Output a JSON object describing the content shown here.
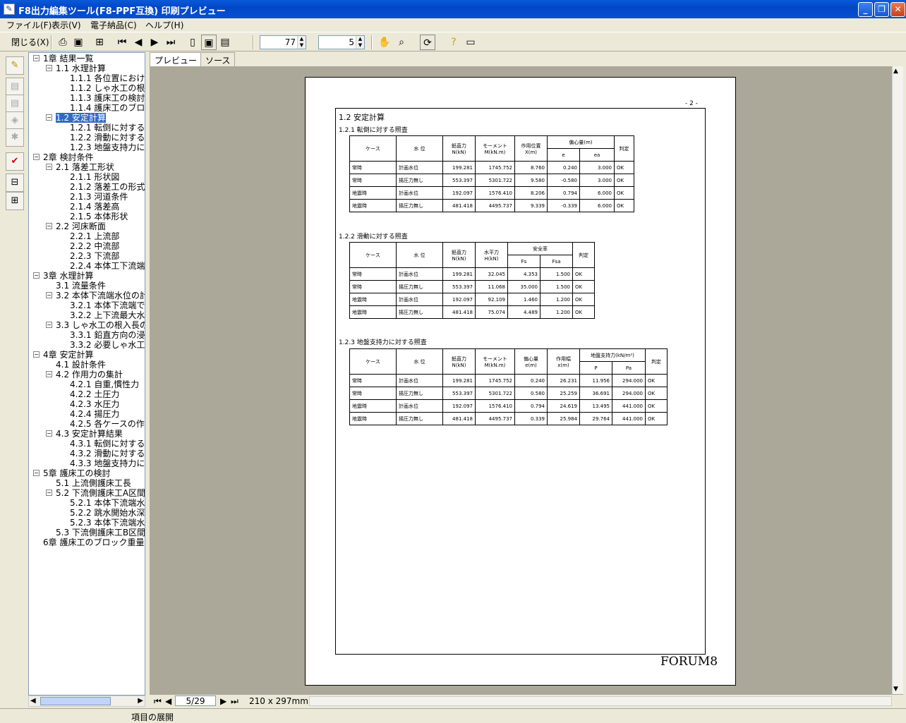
{
  "window": {
    "title": "F8出力編集ツール(F8-PPF互換) 印刷プレビュー",
    "app_icon": "edit-icon"
  },
  "menu": [
    "ファイル(F)",
    "表示(V)",
    "電子納品(C)",
    "ヘルプ(H)"
  ],
  "toolbar": {
    "close_label": "閉じる(X)",
    "zoom_value": "77",
    "pages_value": "5"
  },
  "tree": [
    {
      "label": "1章 結果一覧",
      "level": 0,
      "exp": "−"
    },
    {
      "label": "1.1 水理計算",
      "level": 1,
      "exp": "−"
    },
    {
      "label": "1.1.1 各位置におけ",
      "level": 2
    },
    {
      "label": "1.1.2 しゃ水工の根",
      "level": 2
    },
    {
      "label": "1.1.3 護床工の検討",
      "level": 2
    },
    {
      "label": "1.1.4 護床工のブロ",
      "level": 2
    },
    {
      "label": "1.2 安定計算",
      "level": 1,
      "exp": "−",
      "selected": true
    },
    {
      "label": "1.2.1 転倒に対する",
      "level": 2
    },
    {
      "label": "1.2.2 滑動に対する",
      "level": 2
    },
    {
      "label": "1.2.3 地盤支持力に",
      "level": 2
    },
    {
      "label": "2章 検討条件",
      "level": 0,
      "exp": "−"
    },
    {
      "label": "2.1 落差工形状",
      "level": 1,
      "exp": "−"
    },
    {
      "label": "2.1.1 形状図",
      "level": 2
    },
    {
      "label": "2.1.2 落差工の形式",
      "level": 2
    },
    {
      "label": "2.1.3 河道条件",
      "level": 2
    },
    {
      "label": "2.1.4 落差高",
      "level": 2
    },
    {
      "label": "2.1.5 本体形状",
      "level": 2
    },
    {
      "label": "2.2 河床断面",
      "level": 1,
      "exp": "−"
    },
    {
      "label": "2.2.1 上流部",
      "level": 2
    },
    {
      "label": "2.2.2 中流部",
      "level": 2
    },
    {
      "label": "2.2.3 下流部",
      "level": 2
    },
    {
      "label": "2.2.4 本体工下流端",
      "level": 2
    },
    {
      "label": "3章 水理計算",
      "level": 0,
      "exp": "−"
    },
    {
      "label": "3.1 流量条件",
      "level": 1
    },
    {
      "label": "3.2 本体下流端水位の計",
      "level": 1,
      "exp": "−"
    },
    {
      "label": "3.2.1 本体下流端で",
      "level": 2
    },
    {
      "label": "3.2.2 上下流最大水",
      "level": 2
    },
    {
      "label": "3.3 しゃ水工の根入長の",
      "level": 1,
      "exp": "−"
    },
    {
      "label": "3.3.1 鉛直方向の浸",
      "level": 2
    },
    {
      "label": "3.3.2 必要しゃ水工",
      "level": 2
    },
    {
      "label": "4章 安定計算",
      "level": 0,
      "exp": "−"
    },
    {
      "label": "4.1 設計条件",
      "level": 1
    },
    {
      "label": "4.2 作用力の集計",
      "level": 1,
      "exp": "−"
    },
    {
      "label": "4.2.1 自重,慣性力",
      "level": 2
    },
    {
      "label": "4.2.2 土圧力",
      "level": 2
    },
    {
      "label": "4.2.3 水圧力",
      "level": 2
    },
    {
      "label": "4.2.4 揚圧力",
      "level": 2
    },
    {
      "label": "4.2.5 各ケースの作",
      "level": 2
    },
    {
      "label": "4.3 安定計算結果",
      "level": 1,
      "exp": "−"
    },
    {
      "label": "4.3.1 転倒に対する",
      "level": 2
    },
    {
      "label": "4.3.2 滑動に対する",
      "level": 2
    },
    {
      "label": "4.3.3 地盤支持力に",
      "level": 2
    },
    {
      "label": "5章 護床工の検討",
      "level": 0,
      "exp": "−"
    },
    {
      "label": "5.1 上流側護床工長",
      "level": 1
    },
    {
      "label": "5.2 下流側護床工A区間",
      "level": 1,
      "exp": "−"
    },
    {
      "label": "5.2.1 本体下流端水",
      "level": 2
    },
    {
      "label": "5.2.2 跳水開始水深",
      "level": 2
    },
    {
      "label": "5.2.3 本体下流端水",
      "level": 2
    },
    {
      "label": "5.3 下流側護床工B区間",
      "level": 1
    },
    {
      "label": "6章 護床工のブロック重量",
      "level": 0
    }
  ],
  "tabs": [
    "プレビュー",
    "ソース"
  ],
  "nav": {
    "page": "5/29",
    "paper_size": "210 x 297mm"
  },
  "status": "項目の展開",
  "page": {
    "pageno": "- 2 -",
    "title": "1.2 安定計算",
    "brand": "FORUM8",
    "s1": {
      "title": "1.2.1 転倒に対する照査",
      "headers": {
        "case": "ケース",
        "water": "水 位",
        "vert": "鉛直力",
        "vert_u": "N(kN)",
        "mom": "モーメント",
        "mom_u": "M(kN.m)",
        "pos": "作用位置",
        "pos_u": "X(m)",
        "ecc": "偏心量(m)",
        "e": "e",
        "ea": "ea",
        "judge": "判定"
      },
      "rows": [
        [
          "常時",
          "計画水位",
          "199.281",
          "1745.752",
          "8.760",
          "0.240",
          "3.000",
          "OK"
        ],
        [
          "常時",
          "揚圧力無し",
          "553.397",
          "5301.722",
          "9.580",
          "-0.580",
          "3.000",
          "OK"
        ],
        [
          "地震時",
          "計画水位",
          "192.097",
          "1576.410",
          "8.206",
          "0.794",
          "6.000",
          "OK"
        ],
        [
          "地震時",
          "揚圧力無し",
          "481.418",
          "4495.737",
          "9.339",
          "-0.339",
          "6.000",
          "OK"
        ]
      ]
    },
    "s2": {
      "title": "1.2.2 滑動に対する照査",
      "headers": {
        "case": "ケース",
        "water": "水 位",
        "vert": "鉛直力",
        "vert_u": "N(kN)",
        "hor": "水平力",
        "hor_u": "H(kN)",
        "sf": "安全率",
        "fs": "Fs",
        "fsa": "Fsa",
        "judge": "判定"
      },
      "rows": [
        [
          "常時",
          "計画水位",
          "199.281",
          "32.045",
          "4.353",
          "1.500",
          "OK"
        ],
        [
          "常時",
          "揚圧力無し",
          "553.397",
          "11.068",
          "35.000",
          "1.500",
          "OK"
        ],
        [
          "地震時",
          "計画水位",
          "192.097",
          "92.109",
          "1.460",
          "1.200",
          "OK"
        ],
        [
          "地震時",
          "揚圧力無し",
          "481.418",
          "75.074",
          "4.489",
          "1.200",
          "OK"
        ]
      ]
    },
    "s3": {
      "title": "1.2.3 地盤支持力に対する照査",
      "headers": {
        "case": "ケース",
        "water": "水 位",
        "vert": "鉛直力",
        "vert_u": "N(kN)",
        "mom": "モーメント",
        "mom_u": "M(kN.m)",
        "ecc": "偏心量",
        "ecc_u": "e(m)",
        "width": "作用幅",
        "width_u": "x(m)",
        "bear": "地盤支持力(kN/m²)",
        "p": "P",
        "pa": "Pa",
        "judge": "判定"
      },
      "rows": [
        [
          "常時",
          "計画水位",
          "199.281",
          "1745.752",
          "0.240",
          "26.231",
          "11.956",
          "294.000",
          "OK"
        ],
        [
          "常時",
          "揚圧力無し",
          "553.397",
          "5301.722",
          "0.580",
          "25.259",
          "36.691",
          "294.000",
          "OK"
        ],
        [
          "地震時",
          "計画水位",
          "192.097",
          "1576.410",
          "0.794",
          "24.619",
          "13.495",
          "441.000",
          "OK"
        ],
        [
          "地震時",
          "揚圧力無し",
          "481.418",
          "4495.737",
          "0.339",
          "25.984",
          "29.764",
          "441.000",
          "OK"
        ]
      ]
    }
  }
}
